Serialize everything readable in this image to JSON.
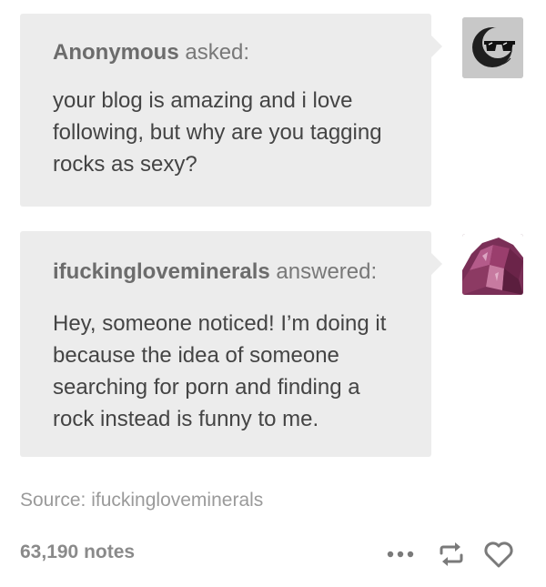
{
  "question": {
    "asker": "Anonymous",
    "verb": "asked:",
    "text": "your blog is amazing and i love following, but why are you tagging rocks as sexy?"
  },
  "answer": {
    "answerer": "ifuckingloveminerals",
    "verb": "answered:",
    "text": "Hey, someone noticed! I’m doing it because the idea of someone searching for porn and finding a rock instead is funny to me."
  },
  "source": "Source: ifuckingloveminerals",
  "notes": "63,190 notes",
  "icons": {
    "asker_avatar": "moon-sunglasses-avatar",
    "answerer_avatar": "amethyst-crystal-avatar",
    "more": "more-dots-icon",
    "reblog": "reblog-icon",
    "like": "heart-icon"
  },
  "colors": {
    "bubble": "#ececec",
    "text": "#444444",
    "muted": "#9a9a9a"
  }
}
